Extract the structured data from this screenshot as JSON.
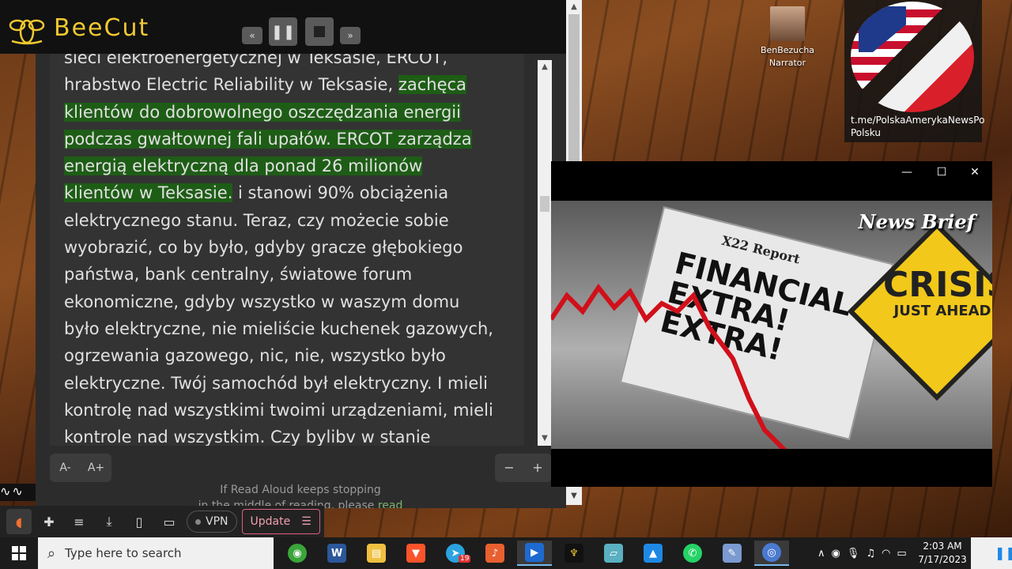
{
  "beecut": {
    "app_name": "BeeCut",
    "rewind_icon": "rewind-icon",
    "pause_icon": "pause-icon",
    "stop_icon": "stop-icon",
    "forward_icon": "fast-forward-icon"
  },
  "desktop": {
    "icon_label_line1": "BenBezucha",
    "icon_label_line2": "Narrator",
    "card_caption_line1": "t.me/PolskaAmerykaNewsPo",
    "card_caption_line2": "Polsku"
  },
  "reader": {
    "line0": "sieci elektroenergetycznej w Teksasie, ERCOT,",
    "line1_plain": "hrabstwo Electric Reliability w Teksasie, ",
    "line1_hl": "zachęca",
    "line2_hl": "klientów do dobrowolnego oszczędzania energii",
    "line3_hl": "podczas gwałtownej fali upałów. ERCOT zarządza",
    "line4_hl": "energią elektryczną dla ponad 26 milionów",
    "line5_hl": "klientów w Teksasie.",
    "line5_plain": " i stanowi 90% obciążenia",
    "line6": "elektrycznego stanu. Teraz, czy możecie sobie",
    "line7": "wyobrazić, co by było, gdyby gracze głębokiego",
    "line8": "państwa, bank centralny, światowe forum",
    "line9": "ekonomiczne, gdyby wszystko w waszym domu",
    "line10": "było elektryczne, nie mieliście kuchenek gazowych,",
    "line11": "ogrzewania gazowego, nic, nie, wszystko było",
    "line12": "elektryczne. Twój samochód był elektryczny. I mieli",
    "line13": "kontrolę nad wszystkimi twoimi urządzeniami, mieli",
    "line14": "kontrole nad wszystkim. Czy bylibv w stanie",
    "font_decrease": "A-",
    "font_increase": "A+",
    "zoom_out": "−",
    "zoom_in": "+",
    "notice_line1": "If Read Aloud keeps stopping",
    "notice_line2_prefix": "in the middle of reading, please ",
    "notice_link": "read"
  },
  "browser_bar": {
    "vpn_label": "VPN",
    "update_label": "Update"
  },
  "video": {
    "minimize": "—",
    "maximize": "☐",
    "close": "✕",
    "news_brief": "News Brief",
    "np_header": "X22 Report",
    "np_financial": "FINANCIAL",
    "np_extra1": "EXTRA!",
    "np_extra2": "EXTRA!",
    "crisis_big": "CRISIS",
    "crisis_small": "JUST AHEAD",
    "accent_red": "#d0101a",
    "sign_yellow": "#f2c81a"
  },
  "taskbar": {
    "search_placeholder": "Type here to search",
    "time": "2:03 AM",
    "date": "7/17/2023",
    "telegram_badge": "19"
  }
}
